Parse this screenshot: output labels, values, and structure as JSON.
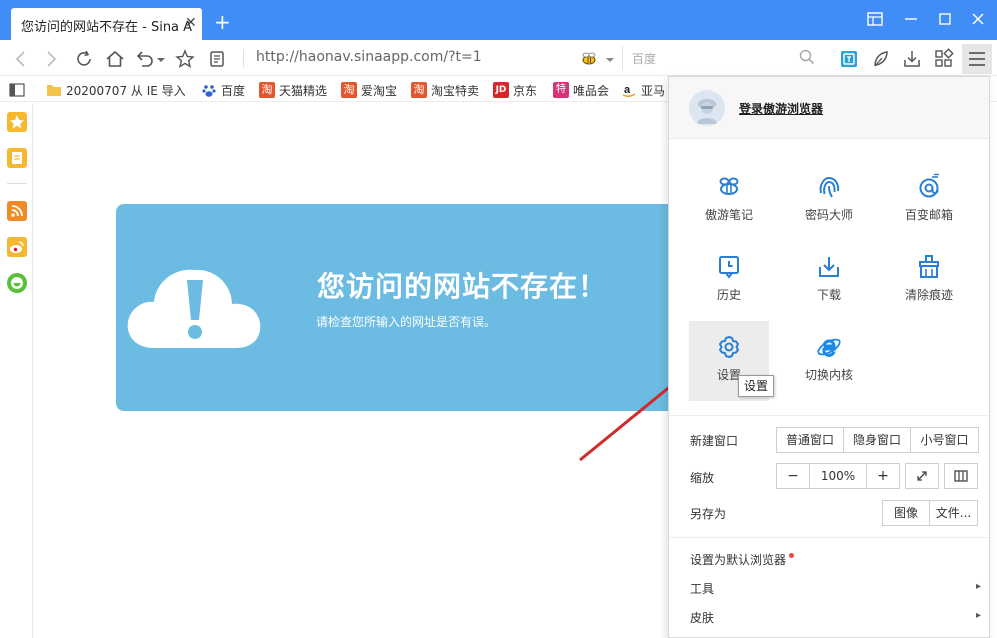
{
  "tab": {
    "title": "您访问的网站不存在 - Sina A",
    "close": "✕",
    "new_tab": "+"
  },
  "nav": {
    "address": "http://haonav.sinaapp.com/?t=1",
    "search_placeholder": "百度"
  },
  "bookmarks": [
    {
      "label": "20200707 从 IE 导入",
      "color": "#f5c24a"
    },
    {
      "label": "百度",
      "color": "#2d5fd6"
    },
    {
      "label": "天猫精选",
      "color": "#e4572e"
    },
    {
      "label": "爱淘宝",
      "color": "#e4572e"
    },
    {
      "label": "淘宝特卖",
      "color": "#e4572e"
    },
    {
      "label": "京东",
      "color": "#d9262c"
    },
    {
      "label": "唯品会",
      "color": "#d6337a"
    },
    {
      "label": "亚马",
      "color": "#222222"
    }
  ],
  "bookmark_badges": {
    "jd": "JD",
    "vip": "特",
    "taobao": "淘"
  },
  "page": {
    "title": "您访问的网站不存在！",
    "subtitle": "请检查您所输入的网址是否有误。"
  },
  "menu": {
    "login": "登录傲游浏览器",
    "items": [
      {
        "label": "傲游笔记"
      },
      {
        "label": "密码大师"
      },
      {
        "label": "百变邮箱"
      },
      {
        "label": "历史"
      },
      {
        "label": "下载"
      },
      {
        "label": "清除痕迹"
      },
      {
        "label": "设置"
      },
      {
        "label": "切换内核"
      }
    ],
    "tooltip": "设置",
    "new_window": {
      "label": "新建窗口",
      "options": [
        "普通窗口",
        "隐身窗口",
        "小号窗口"
      ]
    },
    "zoom": {
      "label": "缩放",
      "minus": "−",
      "value": "100%",
      "plus": "+"
    },
    "save_as": {
      "label": "另存为",
      "options": [
        "图像",
        "文件..."
      ]
    },
    "default_browser": "设置为默认浏览器",
    "tools": "工具",
    "skin": "皮肤",
    "submenu_arrow": "▸"
  },
  "colors": {
    "titlebar": "#3f8df5",
    "banner": "#6bbbe2",
    "accent": "#2a7fd4",
    "arrow": "#d22a2a"
  }
}
